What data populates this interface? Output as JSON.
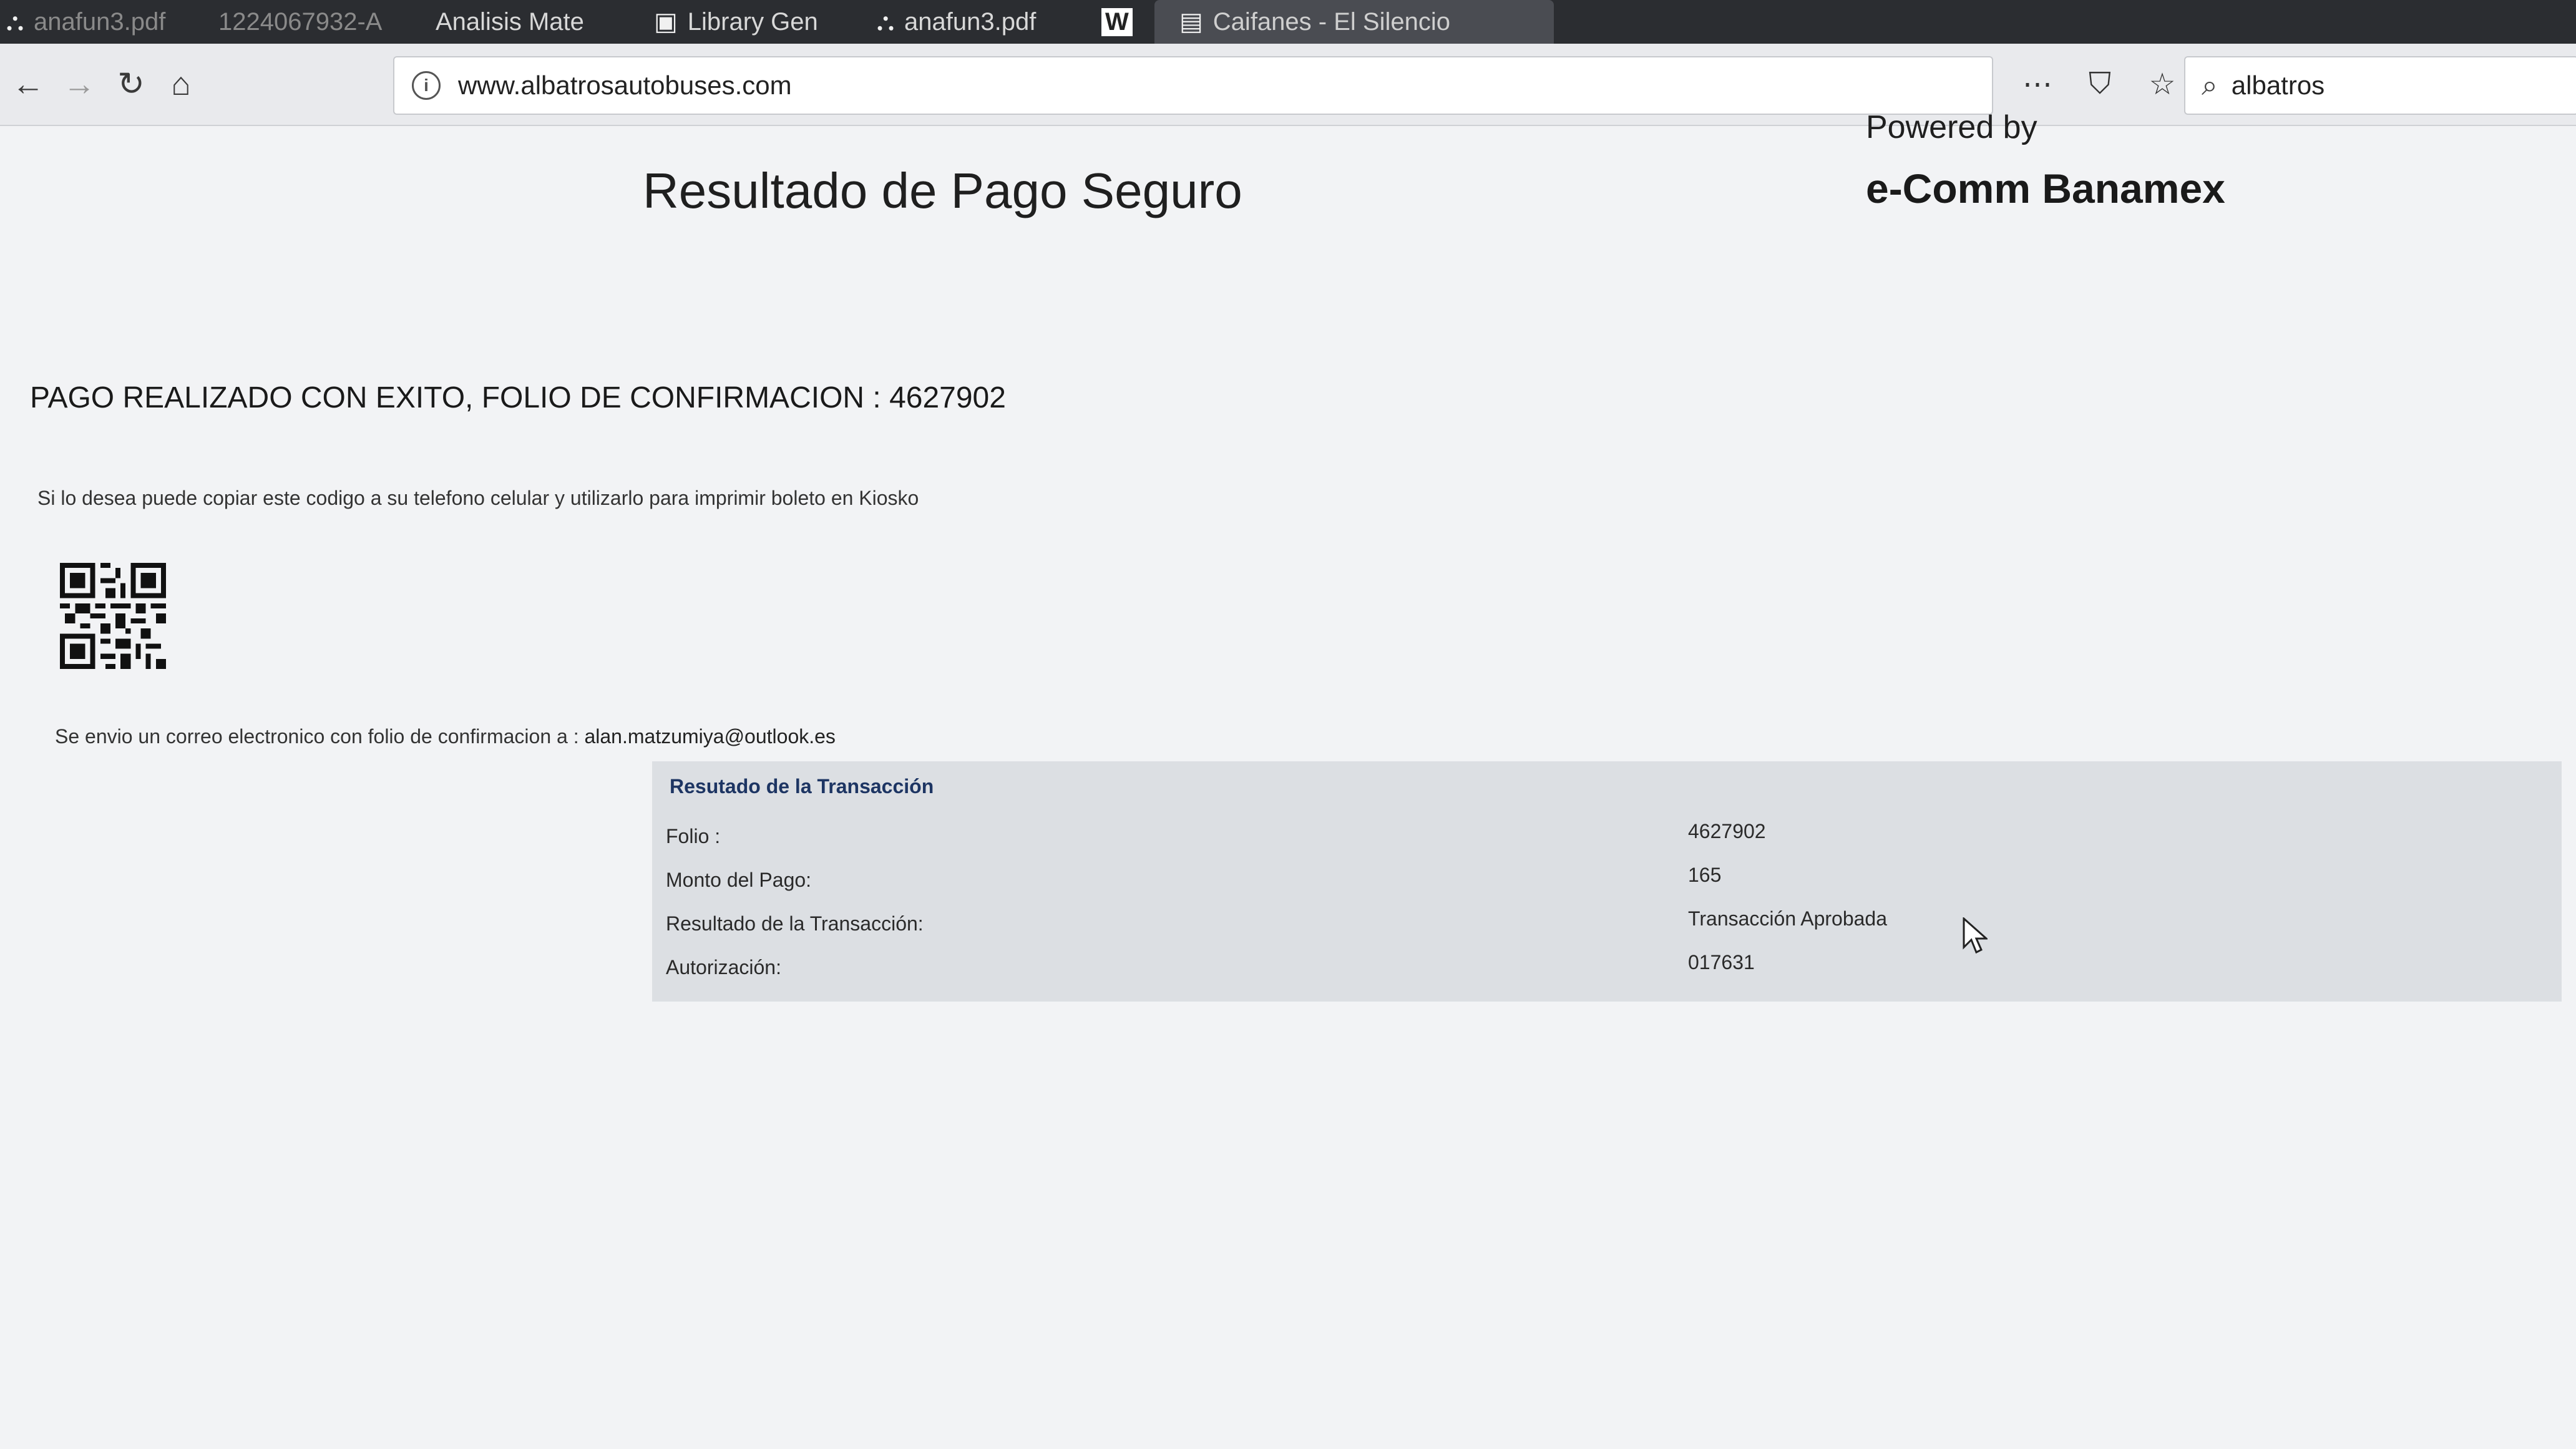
{
  "browser": {
    "tabs": [
      {
        "label": "anafun3.pdf",
        "icon": "pdf-icon",
        "state": "dim"
      },
      {
        "label": "1224067932-A",
        "icon": "",
        "state": "dim"
      },
      {
        "label": "Analisis Mate",
        "icon": "",
        "state": "normal"
      },
      {
        "label": "Library Gen",
        "icon": "document-icon",
        "state": "normal"
      },
      {
        "label": "anafun3.pdf",
        "icon": "pdf-icon",
        "state": "normal"
      },
      {
        "label": "W",
        "icon": "wikipedia-icon",
        "state": "normal"
      },
      {
        "label": "Caifanes - El Silencio",
        "icon": "tab-icon",
        "state": "active"
      }
    ],
    "url": "www.albatrosautobuses.com",
    "search_value": "albatros",
    "actions": [
      "more-icon",
      "pocket-icon",
      "bookmark-star-icon"
    ]
  },
  "page": {
    "title": "Resultado de Pago Seguro",
    "powered_by": "Powered by",
    "brand": "e-Comm Banamex",
    "success_message": "PAGO REALIZADO CON EXITO, FOLIO DE CONFIRMACION : 4627902",
    "qr_hint": "Si lo desea puede copiar este codigo a su telefono celular y utilizarlo para imprimir boleto en Kiosko",
    "email_prefix": "Se envio un correo electronico con folio de confirmacion a :",
    "email_address": "alan.matzumiya@outlook.es",
    "transaction": {
      "header": "Resutado de la Transacción",
      "rows": [
        {
          "label": "Folio :",
          "value": "4627902"
        },
        {
          "label": "Monto del Pago:",
          "value": "165"
        },
        {
          "label": "Resultado de la Transacción:",
          "value": "Transacción Aprobada"
        },
        {
          "label": "Autorización:",
          "value": "017631"
        }
      ]
    }
  }
}
